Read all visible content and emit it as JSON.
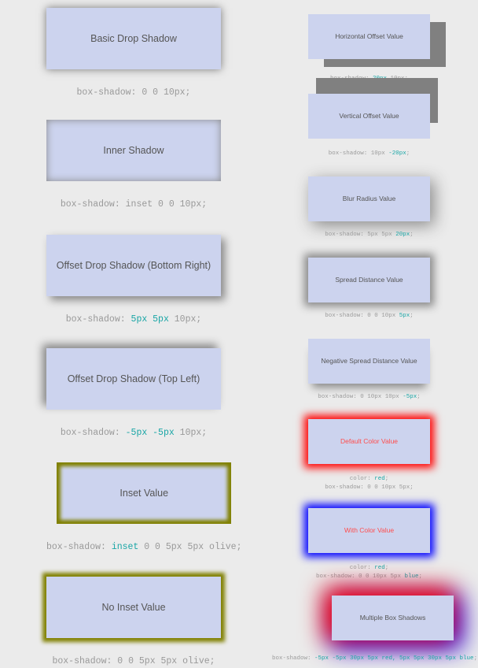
{
  "theme": {
    "page_background": "#ebebeb",
    "box_fill": "#ccd3ee",
    "box_text": "#555555",
    "code_text": "#999999",
    "token_highlight": "#1aa6a6",
    "olive": "#808000",
    "red": "#ff0000",
    "blue": "#0000ff",
    "gray_shadow": "#808080"
  },
  "left_column": [
    {
      "label": "Basic Drop Shadow",
      "code_prefix": "box-shadow: ",
      "code_plain": "0 0 10px;",
      "code_token": "",
      "code_suffix": ""
    },
    {
      "label": "Inner Shadow",
      "code_prefix": "box-shadow: ",
      "code_plain": "inset 0 0 10px;",
      "code_token": "",
      "code_suffix": ""
    },
    {
      "label": "Offset Drop Shadow (Bottom Right)",
      "code_prefix": "box-shadow: ",
      "code_plain": "",
      "code_token": "5px 5px",
      "code_suffix": " 10px;"
    },
    {
      "label": "Offset Drop Shadow (Top Left)",
      "code_prefix": "box-shadow: ",
      "code_plain": "",
      "code_token": "-5px -5px",
      "code_suffix": " 10px;"
    },
    {
      "label": "Inset Value",
      "code_prefix": "box-shadow: ",
      "code_plain": "",
      "code_token": "inset",
      "code_suffix": " 0 0 5px 5px olive;"
    },
    {
      "label": "No Inset Value",
      "code_prefix": "box-shadow: ",
      "code_plain": "0 0 5px 5px olive;",
      "code_token": "",
      "code_suffix": ""
    }
  ],
  "right_column": [
    {
      "label": "Horizontal Offset Value",
      "code_line1_prefix": "box-shadow: ",
      "code_line1_token": "20px",
      "code_line1_suffix": " 10px;",
      "code_line0": ""
    },
    {
      "label": "Vertical Offset Value",
      "code_line1_prefix": "box-shadow: 10px ",
      "code_line1_token": "-20px",
      "code_line1_suffix": ";",
      "code_line0": ""
    },
    {
      "label": "Blur Radius Value",
      "code_line1_prefix": "box-shadow: 5px 5px ",
      "code_line1_token": "20px",
      "code_line1_suffix": ";",
      "code_line0": ""
    },
    {
      "label": "Spread Distance Value",
      "code_line1_prefix": "box-shadow: 0 0 10px ",
      "code_line1_token": "5px",
      "code_line1_suffix": ";",
      "code_line0": ""
    },
    {
      "label": "Negative Spread Distance Value",
      "code_line1_prefix": "box-shadow: 0 10px 10px ",
      "code_line1_token": "-5px",
      "code_line1_suffix": ";",
      "code_line0": ""
    },
    {
      "label": "Default Color Value",
      "code_line0_prefix": "color: ",
      "code_line0_token": "red",
      "code_line0_suffix": ";",
      "code_line1_prefix": "box-shadow: 0 0 10px 5px;",
      "code_line1_token": "",
      "code_line1_suffix": ""
    },
    {
      "label": "With Color Value",
      "code_line0_prefix": "color: ",
      "code_line0_token": "red",
      "code_line0_suffix": ";",
      "code_line1_prefix": "box-shadow: 0 0 10px 5px ",
      "code_line1_token": "blue",
      "code_line1_suffix": ";"
    },
    {
      "label": "Multiple Box Shadows",
      "code_line1_prefix": "box-shadow: ",
      "code_line1_token": "-5px -5px 30px 5px red, 5px 5px 30px 5px blue",
      "code_line1_suffix": ";",
      "code_line0": ""
    }
  ]
}
